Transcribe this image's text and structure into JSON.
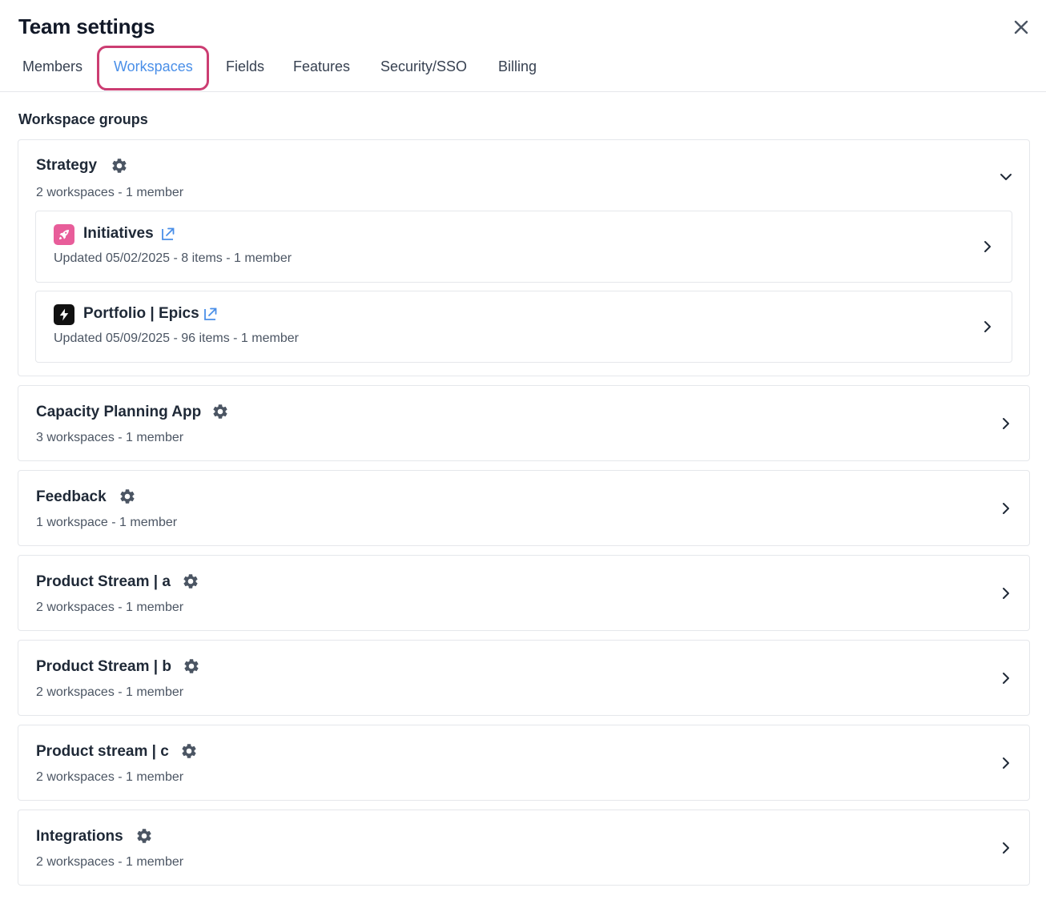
{
  "header": {
    "title": "Team settings",
    "close_icon": "close-icon"
  },
  "tabs": [
    {
      "label": "Members"
    },
    {
      "label": "Workspaces",
      "active": true
    },
    {
      "label": "Fields"
    },
    {
      "label": "Features"
    },
    {
      "label": "Security/SSO"
    },
    {
      "label": "Billing"
    }
  ],
  "colors": {
    "accent": "#4a8fe8",
    "highlight": "#cc3d72",
    "initiatives_icon_bg": "#e85d9a",
    "portfolio_icon_bg": "#111111"
  },
  "section": {
    "title": "Workspace groups"
  },
  "groups": [
    {
      "name": "Strategy",
      "summary": "2 workspaces - 1 member",
      "expanded": true,
      "workspaces": [
        {
          "name": "Initiatives",
          "summary": "Updated 05/02/2025 - 8 items - 1 member",
          "icon": "rocket-icon"
        },
        {
          "name": "Portfolio | Epics",
          "summary": "Updated 05/09/2025 - 96 items - 1 member",
          "icon": "lightning-icon"
        }
      ]
    },
    {
      "name": "Capacity Planning App",
      "summary": "3 workspaces - 1 member",
      "expanded": false
    },
    {
      "name": "Feedback",
      "summary": "1 workspace - 1 member",
      "expanded": false
    },
    {
      "name": "Product Stream | a",
      "summary": "2 workspaces - 1 member",
      "expanded": false
    },
    {
      "name": "Product Stream | b",
      "summary": "2 workspaces - 1 member",
      "expanded": false
    },
    {
      "name": "Product stream | c",
      "summary": "2 workspaces - 1 member",
      "expanded": false
    },
    {
      "name": "Integrations",
      "summary": "2 workspaces - 1 member",
      "expanded": false
    }
  ]
}
